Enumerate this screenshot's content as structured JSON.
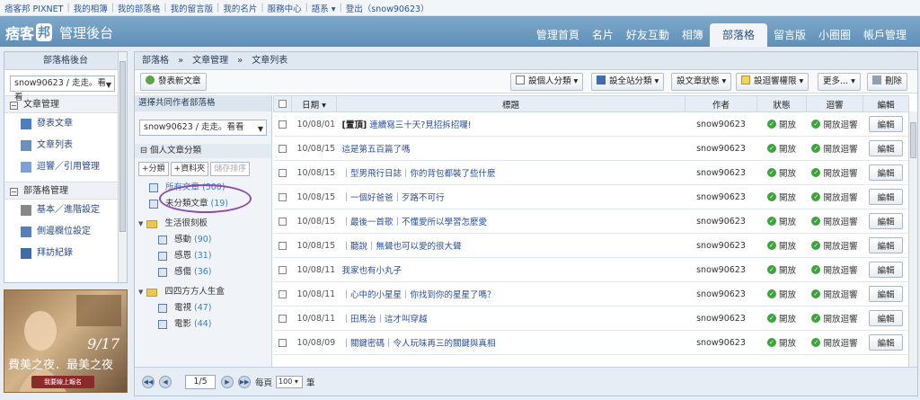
{
  "topbar": {
    "links": [
      "痞客邦 PIXNET",
      "我的相簿",
      "我的部落格",
      "我的留言版",
      "我的名片",
      "服務中心",
      "語系 ▾",
      "登出（snow90623）"
    ]
  },
  "header": {
    "logo": "痞客",
    "logo_badge": "邦",
    "subtitle": "管理後台",
    "nav": [
      "管理首頁",
      "名片",
      "好友互動",
      "相簿",
      "部落格",
      "留言版",
      "小圈圈",
      "帳戶管理"
    ],
    "active_nav": "部落格"
  },
  "sidebar": {
    "title": "部落格後台",
    "blog_select": "snow90623 / 走走。看看",
    "sections": [
      {
        "label": "文章管理",
        "items": [
          "發表文章",
          "文章列表",
          "迴響／引用管理"
        ]
      },
      {
        "label": "部落格管理",
        "items": [
          "基本／進階設定",
          "側邊欄位設定",
          "拜訪紀錄"
        ]
      }
    ]
  },
  "ad": {
    "date": "9/17",
    "title": "費美之夜．最美之夜",
    "button": "我要線上報名"
  },
  "breadcrumb": "部落格　»　文章管理　»　文章列表",
  "toolbar": {
    "new_post": "發表新文章",
    "personal_category": "設個人分類",
    "site_category": "設全站分類",
    "post_status": "設文章狀態",
    "reply_permission": "設迴響權限",
    "more": "更多...",
    "delete": "刪除"
  },
  "left_panel": {
    "header": "選擇共同作者部落格",
    "blog_select": "snow90623 / 走走。看看",
    "category_section": "⊟ 個人文章分類",
    "buttons": [
      "+分類",
      "+資料夾",
      "儲存排序"
    ],
    "tree": [
      {
        "type": "item",
        "label": "所有文章",
        "count": "(500)"
      },
      {
        "type": "item",
        "label": "未分類文章",
        "count": "(19)"
      },
      {
        "type": "folder",
        "label": "生活很刻板",
        "count": ""
      },
      {
        "type": "sub",
        "label": "感動",
        "count": "(90)"
      },
      {
        "type": "sub",
        "label": "感恩",
        "count": "(31)"
      },
      {
        "type": "sub",
        "label": "感傷",
        "count": "(36)"
      },
      {
        "type": "folder",
        "label": "四四方方人生盒",
        "count": ""
      },
      {
        "type": "sub",
        "label": "電視",
        "count": "(47)"
      },
      {
        "type": "sub",
        "label": "電影",
        "count": "(44)"
      }
    ]
  },
  "table": {
    "headers": [
      "",
      "日期",
      "標題",
      "作者",
      "狀態",
      "迴響",
      "編輯"
    ],
    "rows": [
      {
        "date": "10/08/01",
        "prefix": "[置頂]",
        "title": " 連續寫三十天?見招拆招囉!",
        "author": "snow90623",
        "status": "開放",
        "reply": "開放迴響",
        "edit": "編輯"
      },
      {
        "date": "10/08/15",
        "prefix": "",
        "title": "這是第五百篇了嗎",
        "author": "snow90623",
        "status": "開放",
        "reply": "開放迴響",
        "edit": "編輯"
      },
      {
        "date": "10/08/15",
        "prefix": "",
        "title": "｜型男飛行日誌｜你的背包都裝了些什麼",
        "author": "snow90623",
        "status": "開放",
        "reply": "開放迴響",
        "edit": "編輯"
      },
      {
        "date": "10/08/15",
        "prefix": "",
        "title": "｜一個好爸爸｜歹路不可行",
        "author": "snow90623",
        "status": "開放",
        "reply": "開放迴響",
        "edit": "編輯"
      },
      {
        "date": "10/08/15",
        "prefix": "",
        "title": "｜最後一首歌｜不懂愛所以學習怎麼愛",
        "author": "snow90623",
        "status": "開放",
        "reply": "開放迴響",
        "edit": "編輯"
      },
      {
        "date": "10/08/15",
        "prefix": "",
        "title": "｜聽說｜無聲也可以愛的很大聲",
        "author": "snow90623",
        "status": "開放",
        "reply": "開放迴響",
        "edit": "編輯"
      },
      {
        "date": "10/08/11",
        "prefix": "",
        "title": "我家也有小丸子",
        "author": "snow90623",
        "status": "開放",
        "reply": "開放迴響",
        "edit": "編輯"
      },
      {
        "date": "10/08/11",
        "prefix": "",
        "title": "｜心中的小星星｜你找到你的星星了嗎？",
        "author": "snow90623",
        "status": "開放",
        "reply": "開放迴響",
        "edit": "編輯"
      },
      {
        "date": "10/08/11",
        "prefix": "",
        "title": "｜田馬治｜這才叫穿越",
        "author": "snow90623",
        "status": "開放",
        "reply": "開放迴響",
        "edit": "編輯"
      },
      {
        "date": "10/08/09",
        "prefix": "",
        "title": "｜關鍵密碼｜令人玩味再三的關鍵與真相",
        "author": "snow90623",
        "status": "開放",
        "reply": "開放迴響",
        "edit": "編輯"
      }
    ]
  },
  "pager": {
    "page_input": "1/5",
    "per_page_label": "每頁",
    "per_page_value": "100",
    "unit": "筆"
  },
  "colors": {
    "header_blue": "#6b96be",
    "link_blue": "#2a4f9a",
    "status_green": "#3aa53a",
    "highlight_circle": "#8d4ab0"
  }
}
